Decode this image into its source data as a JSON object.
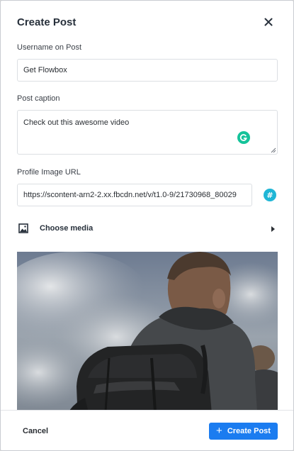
{
  "modal": {
    "title": "Create Post",
    "close_icon": "close-icon"
  },
  "form": {
    "username_label": "Username on Post",
    "username_value": "Get Flowbox",
    "caption_label": "Post caption",
    "caption_value": "Check out this awesome video",
    "profile_url_label": "Profile Image URL",
    "profile_url_value": "https://scontent-arn2-2.xx.fbcdn.net/v/t1.0-9/21730968_80029",
    "grammarly_icon": "grammarly-icon",
    "hashtag_icon": "hashtag-icon",
    "hashtag_glyph": "#"
  },
  "media": {
    "label": "Choose media",
    "icon": "image-icon",
    "expand_icon": "chevron-right-icon"
  },
  "footer": {
    "cancel_label": "Cancel",
    "create_label": "Create Post",
    "create_icon": "plus-icon"
  },
  "colors": {
    "accent": "#1b7cf0",
    "grammarly": "#15c39a",
    "hashtag": "#1fb6d6"
  }
}
